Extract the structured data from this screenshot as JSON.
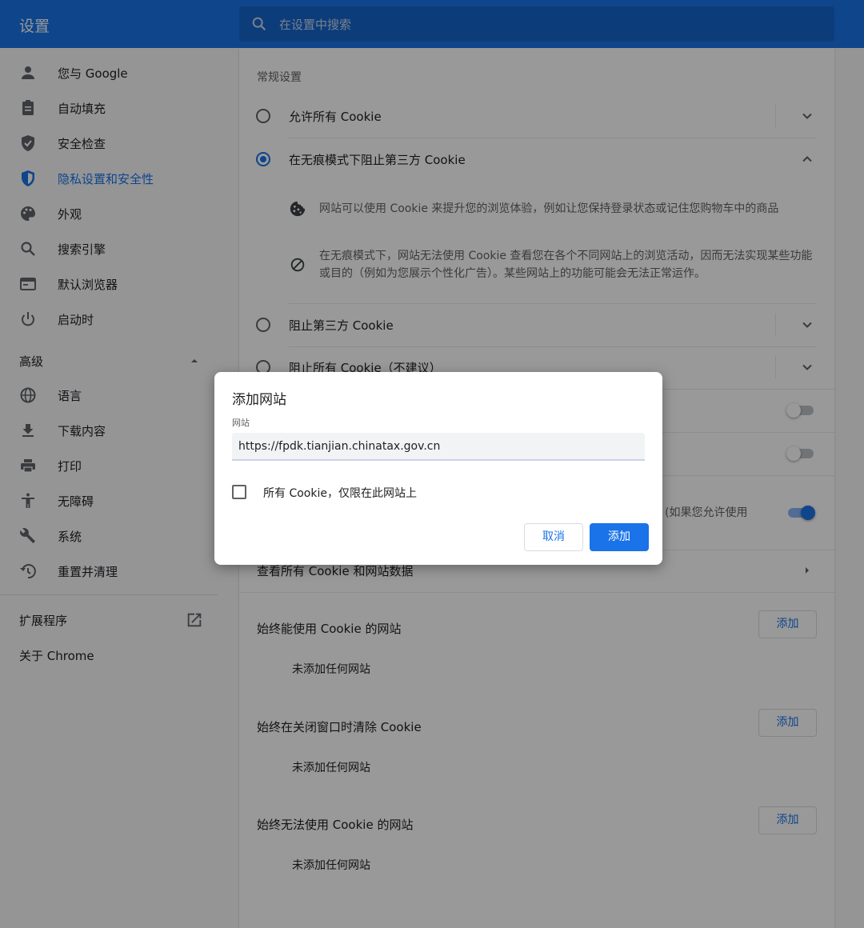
{
  "header": {
    "title": "设置",
    "search_placeholder": "在设置中搜索"
  },
  "sidebar": {
    "items": [
      {
        "label": "您与 Google",
        "icon": "person-icon"
      },
      {
        "label": "自动填充",
        "icon": "clipboard-icon"
      },
      {
        "label": "安全检查",
        "icon": "shield-check-icon"
      },
      {
        "label": "隐私设置和安全性",
        "icon": "privacy-shield-icon",
        "active": true
      },
      {
        "label": "外观",
        "icon": "palette-icon"
      },
      {
        "label": "搜索引擎",
        "icon": "search-icon"
      },
      {
        "label": "默认浏览器",
        "icon": "browser-window-icon"
      },
      {
        "label": "启动时",
        "icon": "power-icon"
      }
    ],
    "advanced_label": "高级",
    "advanced_items": [
      {
        "label": "语言",
        "icon": "globe-icon"
      },
      {
        "label": "下载内容",
        "icon": "download-icon"
      },
      {
        "label": "打印",
        "icon": "printer-icon"
      },
      {
        "label": "无障碍",
        "icon": "accessibility-icon"
      },
      {
        "label": "系统",
        "icon": "wrench-icon"
      },
      {
        "label": "重置并清理",
        "icon": "history-icon"
      }
    ],
    "extensions_label": "扩展程序",
    "about_label": "关于 Chrome"
  },
  "main": {
    "general_settings_label": "常规设置",
    "radio_options": [
      {
        "label": "允许所有 Cookie",
        "checked": false
      },
      {
        "label": "在无痕模式下阻止第三方 Cookie",
        "checked": true
      },
      {
        "label": "阻止第三方 Cookie",
        "checked": false
      },
      {
        "label": "阻止所有 Cookie（不建议）",
        "checked": false
      }
    ],
    "details": [
      {
        "icon": "cookie-icon",
        "text": "网站可以使用 Cookie 来提升您的浏览体验，例如让您保持登录状态或记住您购物车中的商品"
      },
      {
        "icon": "block-icon",
        "text": "在无痕模式下，网站无法使用 Cookie 查看您在各个不同网站上的浏览活动，因而无法实现某些功能或目的（例如为您展示个性化广告）。某些网站上的功能可能会无法正常运作。"
      }
    ],
    "partial_toggle_text": "(如果您允许使用",
    "toggles": [
      false,
      false,
      true
    ],
    "view_all_label": "查看所有 Cookie 和网站数据",
    "sections": [
      {
        "label": "始终能使用 Cookie 的网站",
        "add_label": "添加",
        "empty_label": "未添加任何网站"
      },
      {
        "label": "始终在关闭窗口时清除 Cookie",
        "add_label": "添加",
        "empty_label": "未添加任何网站"
      },
      {
        "label": "始终无法使用 Cookie 的网站",
        "add_label": "添加",
        "empty_label": "未添加任何网站"
      }
    ]
  },
  "dialog": {
    "title": "添加网站",
    "field_label": "网站",
    "field_value": "https://fpdk.tianjian.chinatax.gov.cn",
    "checkbox_label": "所有 Cookie，仅限在此网站上",
    "checkbox_checked": false,
    "cancel_label": "取消",
    "confirm_label": "添加"
  },
  "colors": {
    "accent": "#1a73e8",
    "header": "#1a73e8",
    "scrim": "rgba(0,0,0,0.4)"
  }
}
